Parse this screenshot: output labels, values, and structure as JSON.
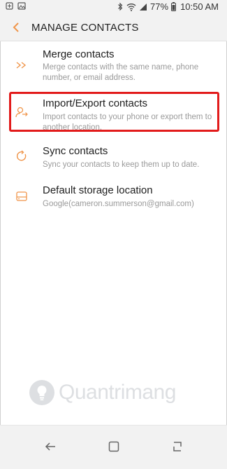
{
  "status_bar": {
    "battery": "77%",
    "time": "10:50 AM"
  },
  "header": {
    "title": "MANAGE CONTACTS"
  },
  "items": [
    {
      "label": "Merge contacts",
      "description": "Merge contacts with the same name, phone number, or email address.",
      "icon": "merge-icon"
    },
    {
      "label": "Import/Export contacts",
      "description": "Import contacts to your phone or export them to another location.",
      "icon": "import-export-icon"
    },
    {
      "label": "Sync contacts",
      "description": "Sync your contacts to keep them up to date.",
      "icon": "sync-icon"
    },
    {
      "label": "Default storage location",
      "description": "Google(cameron.summerson@gmail.com)",
      "icon": "storage-icon"
    }
  ],
  "watermark": {
    "text": "Quantrimang"
  },
  "colors": {
    "accent": "#f0954a",
    "highlight": "#e21b1b"
  }
}
